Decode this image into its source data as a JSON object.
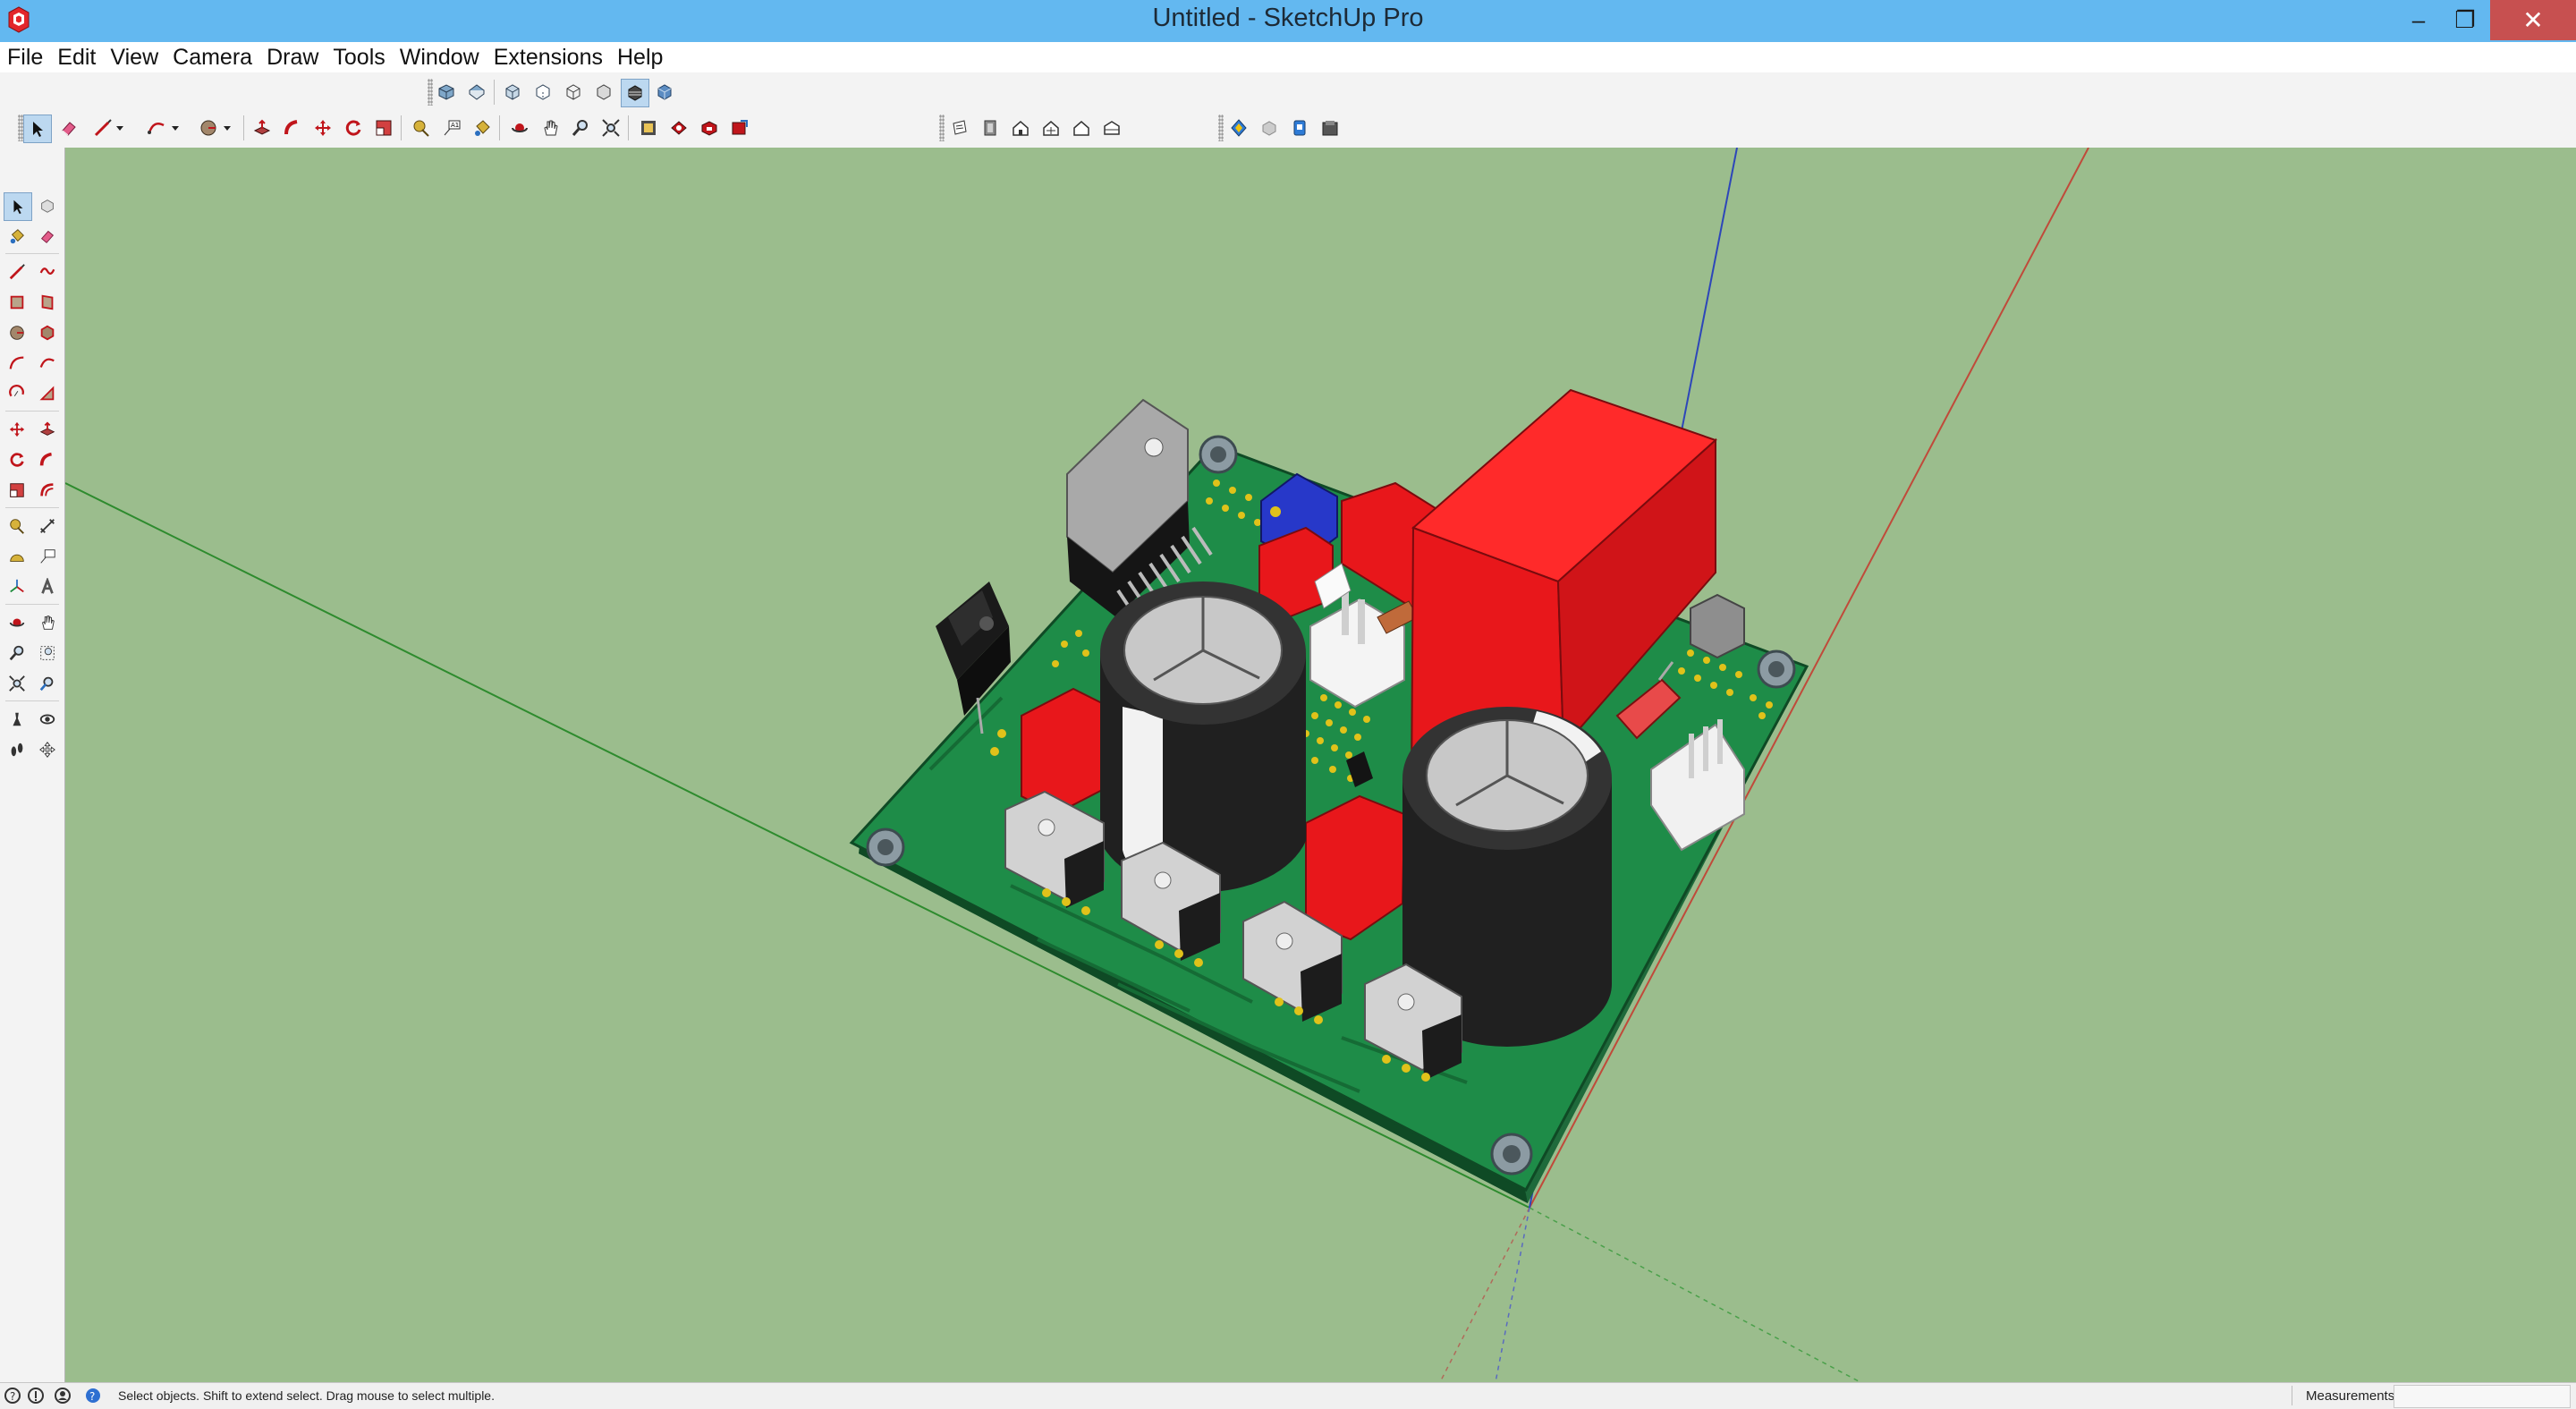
{
  "window": {
    "title": "Untitled - SketchUp Pro",
    "app_icon": "sketchup-logo-icon",
    "controls": {
      "minimize": "–",
      "restore": "❐",
      "close": "✕"
    }
  },
  "menu": [
    "File",
    "Edit",
    "View",
    "Camera",
    "Draw",
    "Tools",
    "Window",
    "Extensions",
    "Help"
  ],
  "toolbars": {
    "views": [
      "iso-view-icon",
      "top-view-icon",
      "front-view-icon",
      "right-view-icon",
      "back-view-icon",
      "left-view-icon",
      "bottom-view-icon"
    ],
    "styles": [
      "xray-icon",
      "back-edges-icon",
      "wireframe-icon",
      "hidden-line-icon",
      "shaded-icon",
      "shaded-textures-icon",
      "monochrome-icon"
    ],
    "main": [
      "select-icon",
      "eraser-icon",
      "line-icon",
      "arc-icon",
      "shapes-icon",
      "push-pull-icon",
      "follow-me-icon",
      "move-icon",
      "rotate-icon",
      "scale-icon",
      "tape-measure-icon",
      "text-icon",
      "paint-bucket-icon",
      "orbit-icon",
      "pan-icon",
      "zoom-icon",
      "zoom-extents-icon",
      "warehouse-icon",
      "extension-warehouse-icon",
      "layout-icon",
      "send-to-layout-icon"
    ],
    "sections": [
      "section-plane-icon",
      "section-cut-icon",
      "house-icon",
      "house-plus-icon",
      "house-outline-icon",
      "house-side-icon"
    ],
    "sandbox": [
      "geo-location-icon",
      "photo-texture-icon",
      "model-info-icon",
      "components-icon"
    ]
  },
  "left_tools": [
    "select-icon",
    "make-component-icon",
    "paint-bucket-icon",
    "eraser-icon",
    "line-icon",
    "freehand-icon",
    "rectangle-icon",
    "rotated-rectangle-icon",
    "circle-icon",
    "polygon-icon",
    "arc-icon",
    "two-point-arc-icon",
    "pie-icon",
    "three-point-arc-icon",
    "move-icon",
    "push-pull-icon",
    "rotate-icon",
    "follow-me-icon",
    "scale-icon",
    "offset-icon",
    "tape-measure-icon",
    "dimension-icon",
    "protractor-icon",
    "text-icon",
    "axes-icon",
    "3d-text-icon",
    "orbit-icon",
    "pan-icon",
    "zoom-icon",
    "zoom-window-icon",
    "zoom-extents-icon",
    "previous-view-icon",
    "position-camera-icon",
    "look-around-icon",
    "walk-icon",
    "section-plane-icon"
  ],
  "status": {
    "hint": "Select objects. Shift to extend select. Drag mouse to select multiple.",
    "measurements_label": "Measurements",
    "measurements_value": ""
  },
  "colors": {
    "viewport_bg": "#9bbd8d",
    "titlebar": "#63b8f0",
    "pcb": "#1e8c48",
    "component_red": "#e8171b",
    "capacitor_black": "#202020"
  }
}
